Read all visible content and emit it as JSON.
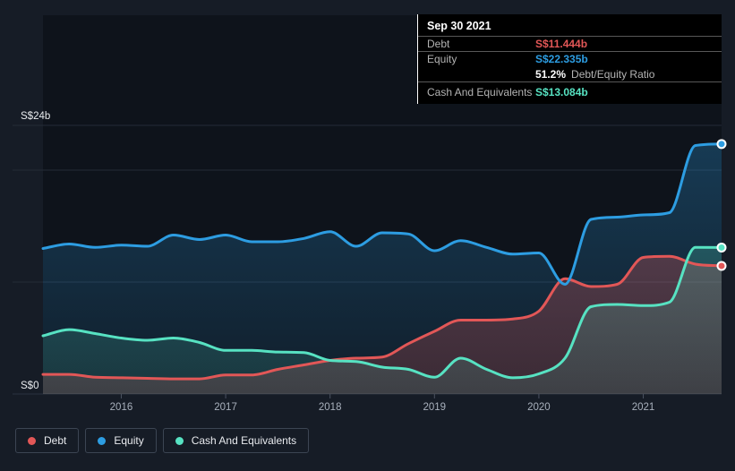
{
  "colors": {
    "debt": "#e25757",
    "equity": "#2d9de2",
    "cash": "#57e2c2",
    "page_bg": "#161c26",
    "plot_bg": "#0e131b",
    "gridline": "#242b37",
    "axis_tick": "#4a5260",
    "year_label": "#a8b0bc",
    "value_label": "#e8ebee",
    "tooltip_bg": "#000000"
  },
  "tooltip": {
    "date": "Sep 30 2021",
    "debt_label": "Debt",
    "debt_value": "S$11.444b",
    "equity_label": "Equity",
    "equity_value": "S$22.335b",
    "ratio_value": "51.2%",
    "ratio_label": "Debt/Equity Ratio",
    "cash_label": "Cash And Equivalents",
    "cash_value": "S$13.084b"
  },
  "legend": {
    "items": [
      {
        "label": "Debt",
        "color": "#e25757"
      },
      {
        "label": "Equity",
        "color": "#2d9de2"
      },
      {
        "label": "Cash And Equivalents",
        "color": "#57e2c2"
      }
    ]
  },
  "chart_data": {
    "type": "area",
    "currency_unit": "S$ billions",
    "x_domain_years": [
      2015.25,
      2021.75
    ],
    "x_step_years": 0.25,
    "x_tick_years": [
      2016,
      2017,
      2018,
      2019,
      2020,
      2021
    ],
    "x_tick_labels": [
      "2016",
      "2017",
      "2018",
      "2019",
      "2020",
      "2021"
    ],
    "ylim": [
      0,
      24
    ],
    "y_label_top": "S$24b",
    "y_label_bottom": "S$0",
    "gridlines_b": [
      24,
      20,
      10,
      0
    ],
    "legend_position": "bottom-left",
    "series": [
      {
        "name": "Equity",
        "color": "#2d9de2",
        "final_label": "S$22.335b",
        "values": [
          13.0,
          13.4,
          13.1,
          13.3,
          13.2,
          14.2,
          13.8,
          14.2,
          13.6,
          13.6,
          13.9,
          14.5,
          13.2,
          14.4,
          14.3,
          12.8,
          13.7,
          13.1,
          12.5,
          12.6,
          9.8,
          15.6,
          15.8,
          16.0,
          16.2,
          22.2,
          22.335
        ]
      },
      {
        "name": "Debt",
        "color": "#e25757",
        "final_label": "S$11.444b",
        "values": [
          1.75,
          1.75,
          1.5,
          1.45,
          1.4,
          1.35,
          1.35,
          1.7,
          1.7,
          2.2,
          2.6,
          3.0,
          3.2,
          3.3,
          4.5,
          5.6,
          6.6,
          6.6,
          6.7,
          7.4,
          10.3,
          9.6,
          9.8,
          12.2,
          12.3,
          11.6,
          11.444
        ]
      },
      {
        "name": "Cash And Equivalents",
        "color": "#57e2c2",
        "final_label": "S$13.084b",
        "values": [
          5.2,
          5.75,
          5.4,
          5.0,
          4.8,
          5.0,
          4.6,
          3.9,
          3.9,
          3.75,
          3.7,
          3.0,
          2.9,
          2.4,
          2.2,
          1.5,
          3.2,
          2.2,
          1.45,
          1.8,
          3.2,
          7.8,
          8.0,
          7.9,
          8.2,
          13.1,
          13.084
        ]
      }
    ]
  }
}
